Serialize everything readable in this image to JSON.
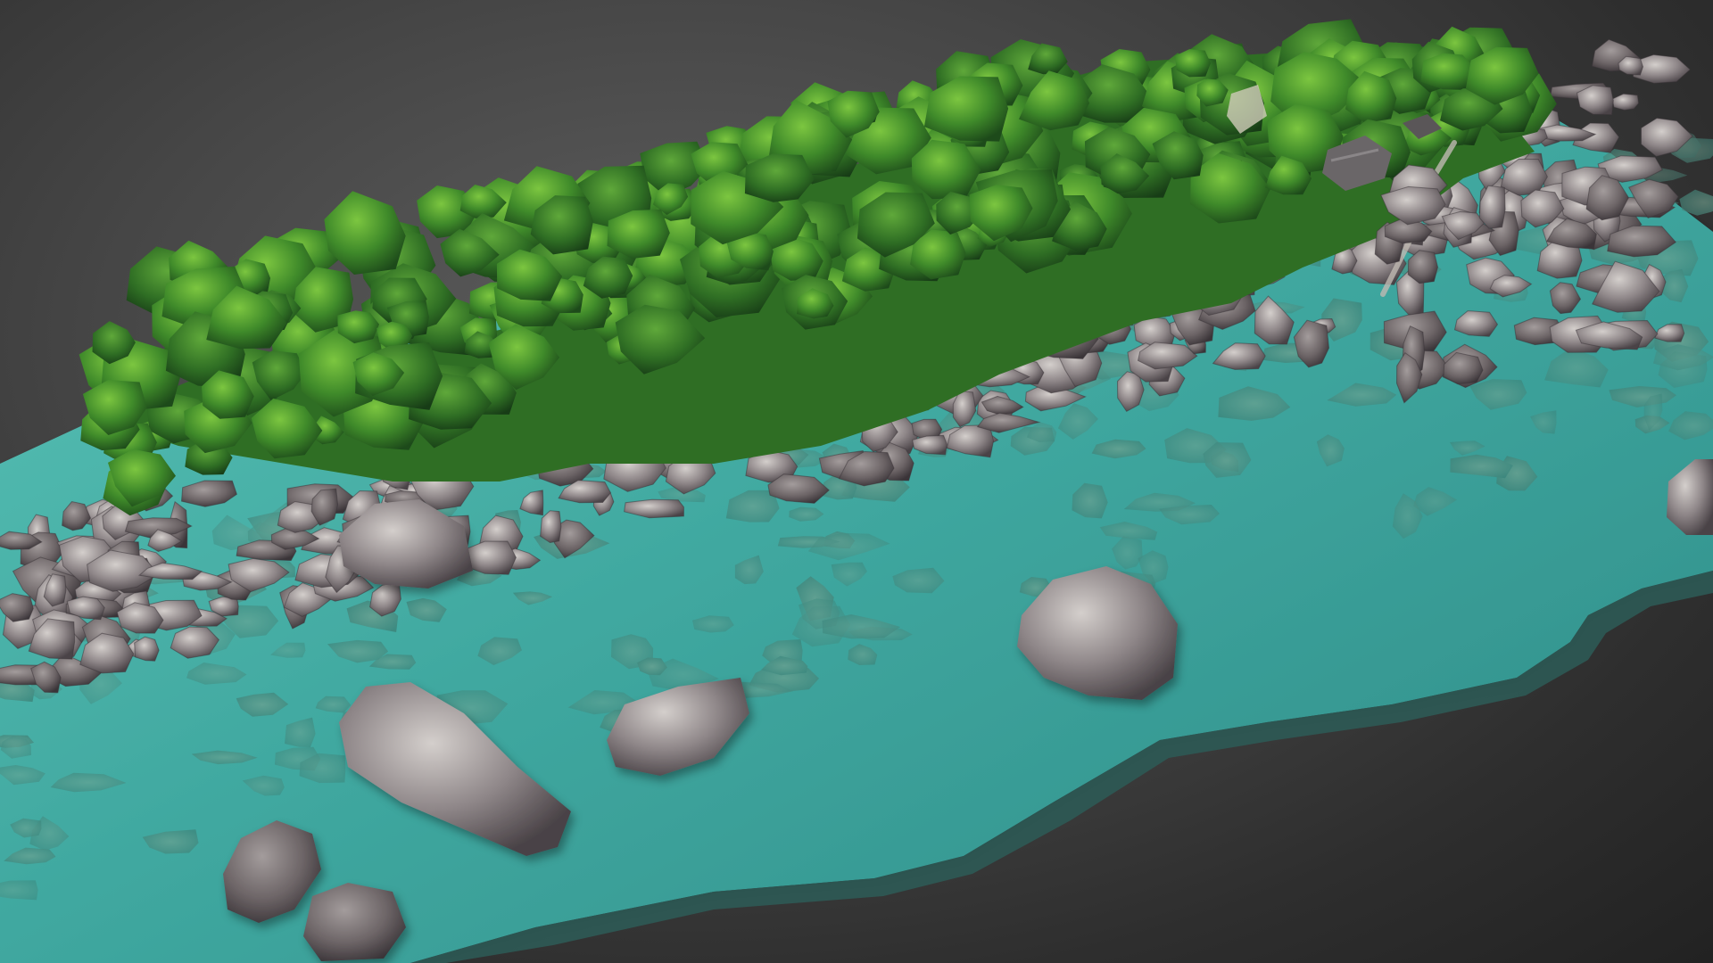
{
  "scene": {
    "subject": "photogrammetry-model",
    "colors": {
      "background_center": "#5e5e5e",
      "background_edge": "#222222",
      "water_light": "#6fd1c4",
      "water_mid": "#3fa79f",
      "water_deep": "#2b7f7c",
      "rock_light": "#c9c3c0",
      "rock_mid": "#8a8284",
      "rock_dark": "#4c4548",
      "foliage_light": "#6fbf3a",
      "foliage_mid": "#3f8a2a",
      "foliage_dark": "#1f4f1c",
      "hut_roof": "#6a6668"
    }
  }
}
